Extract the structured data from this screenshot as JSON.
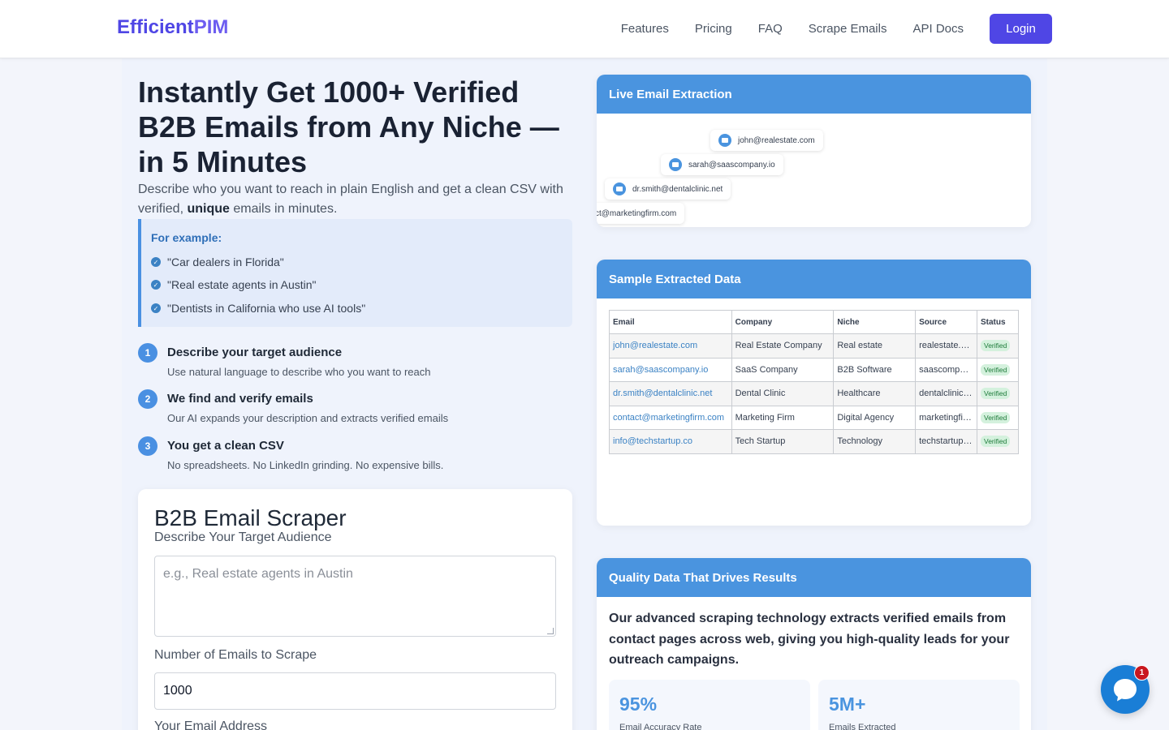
{
  "header": {
    "brand_primary": "Efficient",
    "brand_secondary": "PIM",
    "nav": [
      "Features",
      "Pricing",
      "FAQ",
      "Scrape Emails",
      "API Docs"
    ],
    "login_label": "Login"
  },
  "hero": {
    "title": "Instantly Get 1000+ Verified B2B Emails from Any Niche — in 5 Minutes",
    "subtitle_before": "Describe who you want to reach in plain English and get a clean CSV with verified, ",
    "subtitle_bold": "unique",
    "subtitle_after": " emails in minutes."
  },
  "examples": {
    "title": "For example:",
    "items": [
      "\"Car dealers in Florida\"",
      "\"Real estate agents in Austin\"",
      "\"Dentists in California who use AI tools\""
    ]
  },
  "steps": [
    {
      "num": "1",
      "title": "Describe your target audience",
      "desc": "Use natural language to describe who you want to reach"
    },
    {
      "num": "2",
      "title": "We find and verify emails",
      "desc": "Our AI expands your description and extracts verified emails"
    },
    {
      "num": "3",
      "title": "You get a clean CSV",
      "desc": "No spreadsheets. No LinkedIn grinding. No expensive bills."
    }
  ],
  "form": {
    "title": "B2B Email Scraper",
    "audience_label": "Describe Your Target Audience",
    "audience_placeholder": "e.g., Real estate agents in Austin",
    "count_label": "Number of Emails to Scrape",
    "count_value": "1000",
    "email_label": "Your Email Address"
  },
  "live": {
    "title": "Live Email Extraction",
    "chips": [
      "john@realestate.com",
      "sarah@saascompany.io",
      "dr.smith@dentalclinic.net",
      "ct@marketingfirm.com"
    ]
  },
  "sample": {
    "title": "Sample Extracted Data",
    "columns": [
      "Email",
      "Company",
      "Niche",
      "Source",
      "Status"
    ],
    "rows": [
      [
        "john@realestate.com",
        "Real Estate Company",
        "Real estate",
        "realestate.com",
        "Verified"
      ],
      [
        "sarah@saascompany.io",
        "SaaS Company",
        "B2B Software",
        "saascompany.io",
        "Verified"
      ],
      [
        "dr.smith@dentalclinic.net",
        "Dental Clinic",
        "Healthcare",
        "dentalclinic.net",
        "Verified"
      ],
      [
        "contact@marketingfirm.com",
        "Marketing Firm",
        "Digital Agency",
        "marketingfirm.com",
        "Verified"
      ],
      [
        "info@techstartup.co",
        "Tech Startup",
        "Technology",
        "techstartup.co",
        "Verified"
      ]
    ]
  },
  "quality": {
    "title": "Quality Data That Drives Results",
    "text": "Our advanced scraping technology extracts verified emails from contact pages across web, giving you high-quality leads for your outreach campaigns.",
    "stats": [
      {
        "value": "95%",
        "label": "Email Accuracy Rate"
      },
      {
        "value": "5M+",
        "label": "Emails Extracted"
      }
    ]
  },
  "chat": {
    "badge": "1"
  },
  "colors": {
    "brand": "#4f46e5",
    "accent": "#4a94df",
    "verified": "#1e7b3a",
    "badge": "#c9171e"
  }
}
